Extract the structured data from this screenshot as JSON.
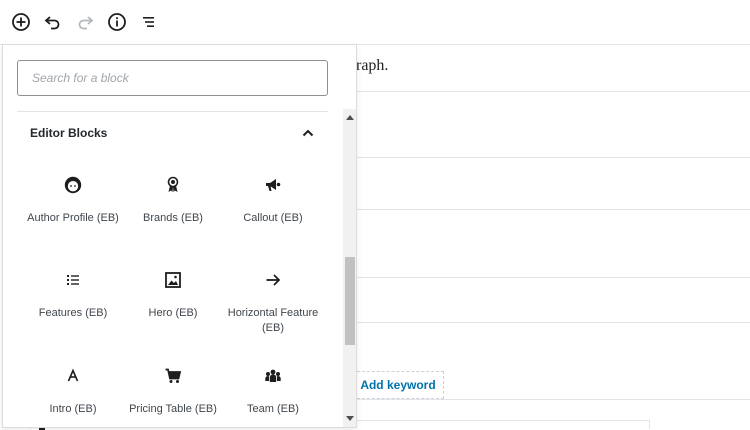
{
  "toolbar": {
    "items": [
      {
        "name": "add-block",
        "icon": "plus-circle-icon"
      },
      {
        "name": "undo",
        "icon": "undo-icon"
      },
      {
        "name": "redo",
        "icon": "redo-icon"
      },
      {
        "name": "info",
        "icon": "info-icon"
      },
      {
        "name": "outline",
        "icon": "list-outline-icon"
      }
    ]
  },
  "editor": {
    "paragraph_fragment": "raph.",
    "add_keyword_label": "Add keyword"
  },
  "inserter": {
    "search_placeholder": "Search for a block",
    "panel_title": "Editor Blocks",
    "blocks": [
      {
        "label": "Author Profile (EB)",
        "icon": "face-icon"
      },
      {
        "label": "Brands (EB)",
        "icon": "award-ribbon-icon"
      },
      {
        "label": "Callout (EB)",
        "icon": "megaphone-icon"
      },
      {
        "label": "Features (EB)",
        "icon": "bullet-list-icon"
      },
      {
        "label": "Hero (EB)",
        "icon": "image-icon"
      },
      {
        "label": "Horizontal Feature (EB)",
        "icon": "arrow-right-icon"
      },
      {
        "label": "Intro (EB)",
        "icon": "letter-a-icon"
      },
      {
        "label": "Pricing Table (EB)",
        "icon": "cart-icon"
      },
      {
        "label": "Team (EB)",
        "icon": "groups-icon"
      }
    ]
  },
  "colors": {
    "icon": "#1e1e1e",
    "link_blue": "#0073aa",
    "border": "#e2e4e7"
  }
}
